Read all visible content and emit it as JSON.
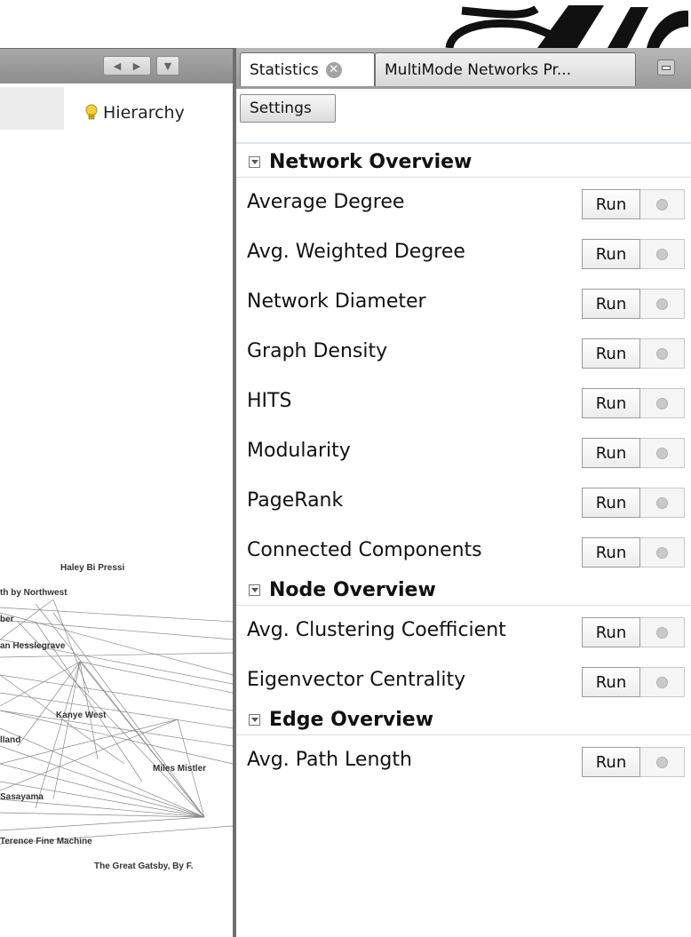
{
  "left_panel": {
    "toolbar": {
      "hierarchy_label": "Hierarchy"
    },
    "graph_labels": [
      "Haley Bi Pressi",
      "th by Northwest",
      "ber",
      "an Hesslegrave",
      "Kanye West",
      "lland",
      "Miles Mistler",
      "Sasayama",
      "Terence Fine Machine",
      "The Great Gatsby, By F."
    ]
  },
  "tabs": {
    "active": {
      "label": "Statistics"
    },
    "inactive": {
      "label": "MultiMode Networks Pr..."
    }
  },
  "settings_label": "Settings",
  "run_label": "Run",
  "sections": [
    {
      "title": "Network Overview",
      "items": [
        "Average Degree",
        "Avg. Weighted Degree",
        "Network Diameter",
        "Graph Density",
        "HITS",
        "Modularity",
        "PageRank",
        "Connected Components"
      ]
    },
    {
      "title": "Node Overview",
      "items": [
        "Avg. Clustering Coefficient",
        "Eigenvector Centrality"
      ]
    },
    {
      "title": "Edge Overview",
      "items": [
        "Avg. Path Length"
      ]
    }
  ],
  "colors": {
    "titlebar": "#9a9a9a",
    "divider": "#6f6f6f",
    "section_line": "#dcdcdc"
  }
}
